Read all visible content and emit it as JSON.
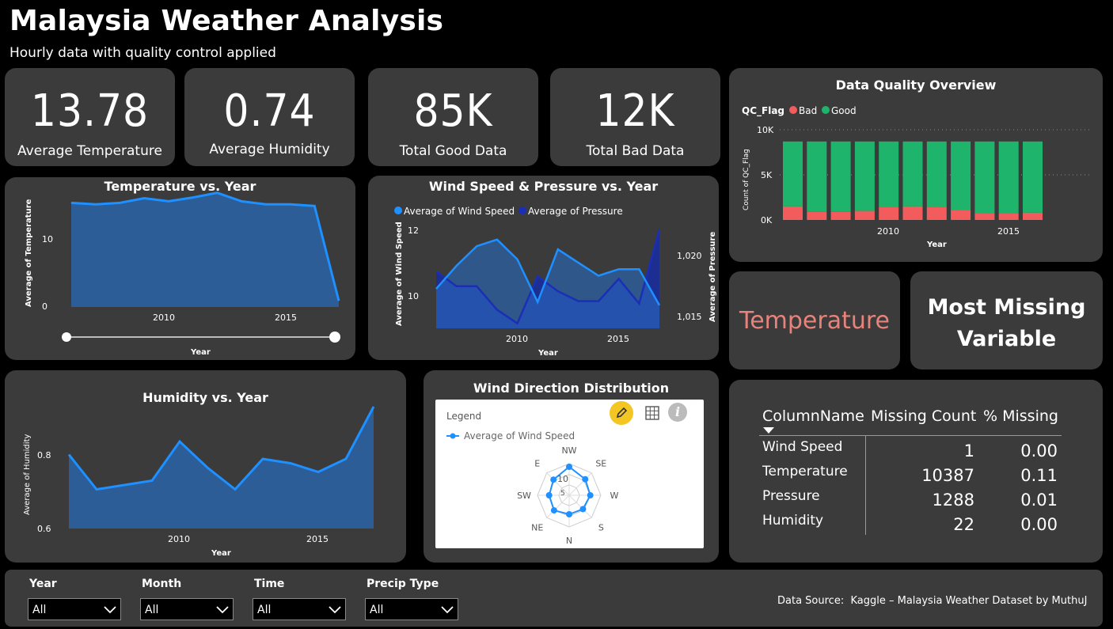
{
  "header": {
    "title": "Malaysia Weather Analysis",
    "subtitle": "Hourly data with quality control applied"
  },
  "kpis": [
    {
      "value": "13.78",
      "label": "Average Temperature"
    },
    {
      "value": "0.74",
      "label": "Average Humidity"
    },
    {
      "value": "85K",
      "label": "Total Good Data"
    },
    {
      "value": "12K",
      "label": "Total Bad Data"
    }
  ],
  "colors": {
    "background": "#000000",
    "card": "#3b3b3b",
    "area_blue": "#2a79d1",
    "dark_blue": "#1a237e",
    "good": "#1fb46b",
    "bad": "#f25c5c",
    "highlight_text": "#e8837c"
  },
  "temp_chart": {
    "title": "Temperature vs. Year",
    "ylabel": "Average of Temperature",
    "xlabel": "Year",
    "yticks": [
      "10",
      "0"
    ],
    "xticks": [
      "2010",
      "2015"
    ]
  },
  "wind_chart": {
    "title": "Wind Speed & Pressure vs. Year",
    "legend": [
      "Average of Wind Speed",
      "Average of Pressure"
    ],
    "ylabel_left": "Average of Wind Speed",
    "ylabel_right": "Average of Pressure",
    "xlabel": "Year",
    "yticks_left": [
      "12",
      "10"
    ],
    "yticks_right": [
      "1,020",
      "1,015"
    ],
    "xticks": [
      "2010",
      "2015"
    ]
  },
  "quality_chart": {
    "title": "Data Quality Overview",
    "legend_title": "QC_Flag",
    "legend": [
      "Bad",
      "Good"
    ],
    "ylabel": "Count of QC_Flag",
    "xlabel": "Year",
    "yticks": [
      "10K",
      "5K",
      "0K"
    ],
    "xticks": [
      "2010",
      "2015"
    ]
  },
  "missing_card": {
    "variable": "Temperature",
    "label": "Most Missing Variable"
  },
  "humidity_chart": {
    "title": "Humidity vs. Year",
    "ylabel": "Average of Humidity",
    "xlabel": "Year",
    "yticks": [
      "0.8",
      "0.6"
    ],
    "xticks": [
      "2010",
      "2015"
    ]
  },
  "wind_dir": {
    "title": "Wind Direction Distribution",
    "legend_title": "Legend",
    "legend_item": "Average of Wind Speed",
    "directions": [
      "NW",
      "SE",
      "W",
      "S",
      "N",
      "NE",
      "SW",
      "E"
    ],
    "values": [
      10.8,
      8.6,
      8.0,
      7.4,
      7.2,
      8.1,
      7.6,
      8.4
    ],
    "ticks": [
      "10",
      "5"
    ],
    "icons": [
      "pencil-icon",
      "table-icon",
      "info-icon"
    ]
  },
  "missing_table": {
    "headers": [
      "ColumnName",
      "Missing Count",
      "% Missing"
    ],
    "rows": [
      {
        "name": "Wind Speed",
        "count": "1",
        "pct": "0.00"
      },
      {
        "name": "Temperature",
        "count": "10387",
        "pct": "0.11"
      },
      {
        "name": "Pressure",
        "count": "1288",
        "pct": "0.01"
      },
      {
        "name": "Humidity",
        "count": "22",
        "pct": "0.00"
      }
    ]
  },
  "filters": [
    {
      "label": "Year",
      "value": "All"
    },
    {
      "label": "Month",
      "value": "All"
    },
    {
      "label": "Time",
      "value": "All"
    },
    {
      "label": "Precip Type",
      "value": "All"
    }
  ],
  "footer": {
    "source": "Data Source:  Kaggle – Malaysia Weather Dataset by MuthuJ"
  },
  "chart_data": [
    {
      "type": "area",
      "title": "Temperature vs. Year",
      "xlabel": "Year",
      "ylabel": "Average of Temperature",
      "x": [
        2006,
        2007,
        2008,
        2009,
        2010,
        2011,
        2012,
        2013,
        2014,
        2015,
        2016,
        2017
      ],
      "values": [
        13.5,
        13.3,
        13.5,
        14.1,
        13.7,
        14.2,
        14.8,
        13.7,
        13.3,
        13.3,
        13.1,
        0.8
      ],
      "ylim": [
        0,
        16
      ]
    },
    {
      "type": "area",
      "title": "Wind Speed & Pressure vs. Year",
      "xlabel": "Year",
      "x": [
        2006,
        2007,
        2008,
        2009,
        2010,
        2011,
        2012,
        2013,
        2014,
        2015,
        2016,
        2017
      ],
      "series": [
        {
          "name": "Average of Wind Speed",
          "axis": "left",
          "values": [
            10.2,
            10.9,
            11.5,
            11.7,
            11.1,
            9.8,
            11.4,
            11.0,
            10.6,
            10.8,
            10.8,
            9.7
          ],
          "ylim": [
            9,
            12.2
          ]
        },
        {
          "name": "Average of Pressure",
          "axis": "right",
          "values": [
            1017.6,
            1016.4,
            1016.4,
            1014.5,
            1013.4,
            1017.2,
            1016.0,
            1015.2,
            1015.2,
            1017.0,
            1015.0,
            1021.0
          ],
          "ylim": [
            1013,
            1021.5
          ]
        }
      ]
    },
    {
      "type": "bar",
      "title": "Data Quality Overview",
      "xlabel": "Year",
      "ylabel": "Count of QC_Flag",
      "x": [
        2006,
        2007,
        2008,
        2009,
        2010,
        2011,
        2012,
        2013,
        2014,
        2015,
        2016
      ],
      "series": [
        {
          "name": "Bad",
          "values": [
            1500,
            900,
            900,
            1000,
            1400,
            1500,
            1400,
            1100,
            700,
            700,
            800
          ]
        },
        {
          "name": "Good",
          "values": [
            7200,
            7800,
            7800,
            7700,
            7300,
            7200,
            7300,
            7600,
            8000,
            8000,
            7900
          ]
        }
      ],
      "stacked": true,
      "ylim": [
        0,
        10000
      ]
    },
    {
      "type": "area",
      "title": "Humidity vs. Year",
      "xlabel": "Year",
      "ylabel": "Average of Humidity",
      "x": [
        2006,
        2007,
        2008,
        2009,
        2010,
        2011,
        2012,
        2013,
        2014,
        2015,
        2016,
        2017
      ],
      "values": [
        0.77,
        0.69,
        0.7,
        0.71,
        0.8,
        0.74,
        0.69,
        0.76,
        0.75,
        0.73,
        0.76,
        0.88
      ],
      "ylim": [
        0.6,
        0.9
      ]
    }
  ]
}
